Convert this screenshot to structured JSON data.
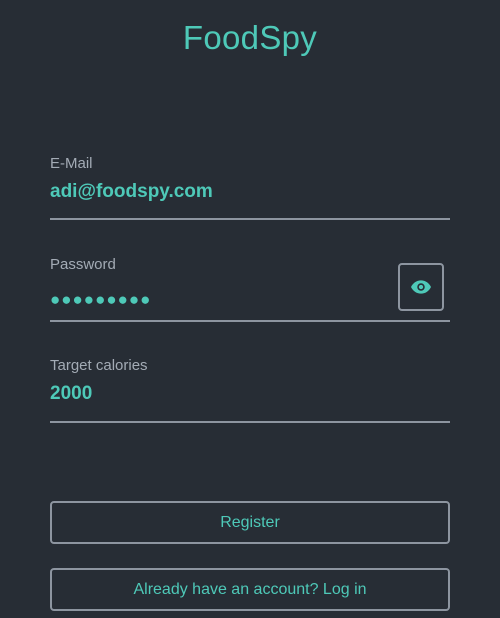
{
  "app": {
    "title": "FoodSpy"
  },
  "form": {
    "email": {
      "label": "E-Mail",
      "value": "adi@foodspy.com"
    },
    "password": {
      "label": "Password",
      "masked_value": "●●●●●●●●●",
      "toggle_icon": "eye-icon"
    },
    "calories": {
      "label": "Target calories",
      "value": "2000"
    }
  },
  "actions": {
    "register_label": "Register",
    "login_label": "Already have an account? Log in"
  },
  "colors": {
    "background": "#272d35",
    "accent": "#4ec9b8",
    "label": "#a3abb5",
    "border": "#8d95a0"
  }
}
